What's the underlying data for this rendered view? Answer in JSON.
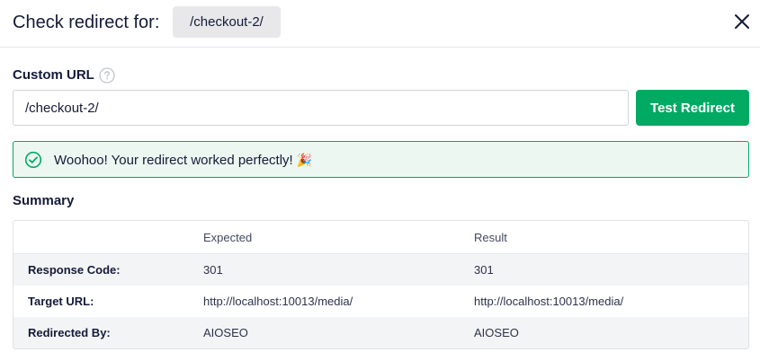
{
  "header": {
    "title": "Check redirect for:",
    "path": "/checkout-2/",
    "close_icon": "close-icon"
  },
  "custom_url": {
    "label": "Custom URL",
    "help_icon": "question-circle-icon",
    "value": "/checkout-2/",
    "button_label": "Test Redirect"
  },
  "alert": {
    "icon": "check-circle-icon",
    "message": "Woohoo! Your redirect worked perfectly!",
    "emoji": "🎉"
  },
  "summary": {
    "title": "Summary",
    "columns": [
      "",
      "Expected",
      "Result"
    ],
    "rows": [
      {
        "label": "Response Code:",
        "expected": "301",
        "result": "301"
      },
      {
        "label": "Target URL:",
        "expected": "http://localhost:10013/media/",
        "result": "http://localhost:10013/media/"
      },
      {
        "label": "Redirected By:",
        "expected": "AIOSEO",
        "result": "AIOSEO"
      }
    ]
  },
  "colors": {
    "accent_green": "#00aa63",
    "alert_bg": "#edf7f1",
    "text": "#141b38"
  }
}
